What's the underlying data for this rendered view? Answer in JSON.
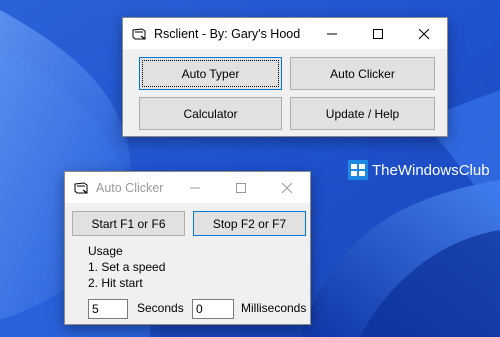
{
  "colors": {
    "accent": "#0078d7",
    "desktop": "#1d4fc9"
  },
  "watermark": {
    "text": "TheWindowsClub"
  },
  "main_window": {
    "title": "Rsclient - By: Gary's Hood",
    "buttons": {
      "auto_typer": "Auto Typer",
      "auto_clicker": "Auto Clicker",
      "calculator": "Calculator",
      "update_help": "Update / Help"
    },
    "controls": [
      "minimize-icon",
      "maximize-icon",
      "close-icon"
    ]
  },
  "clicker_window": {
    "title": "Auto Clicker",
    "buttons": {
      "start": "Start F1 or F6",
      "stop": "Stop F2 or F7"
    },
    "usage": {
      "heading": "Usage",
      "step1": "1. Set a speed",
      "step2": "2. Hit start"
    },
    "seconds": {
      "value": "5",
      "label": "Seconds"
    },
    "milliseconds": {
      "value": "0",
      "label": "Milliseconds"
    }
  }
}
